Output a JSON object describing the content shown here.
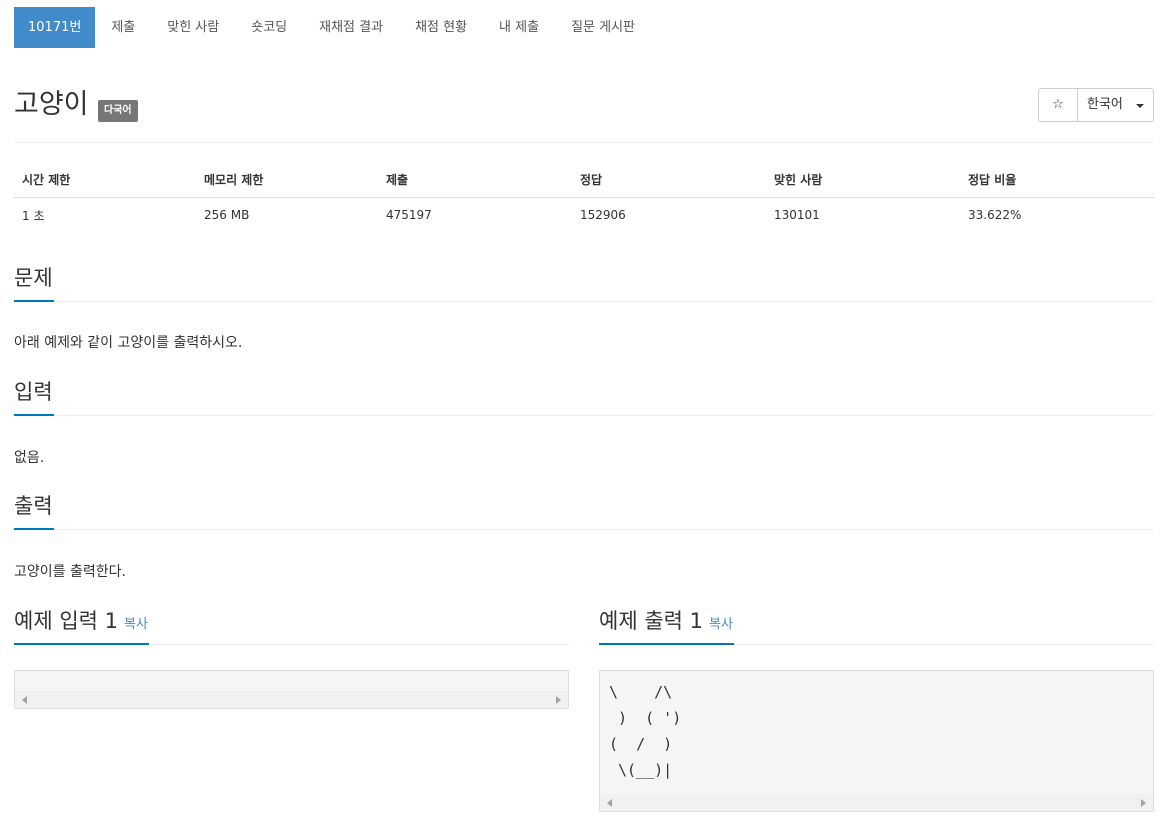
{
  "tabs": [
    {
      "label": "10171번",
      "active": true
    },
    {
      "label": "제출"
    },
    {
      "label": "맞힌 사람"
    },
    {
      "label": "숏코딩"
    },
    {
      "label": "재채점 결과"
    },
    {
      "label": "채점 현황"
    },
    {
      "label": "내 제출"
    },
    {
      "label": "질문 게시판"
    }
  ],
  "problem": {
    "title": "고양이",
    "badge": "다국어",
    "star_icon": "☆",
    "language": "한국어"
  },
  "info": {
    "headers": [
      "시간 제한",
      "메모리 제한",
      "제출",
      "정답",
      "맞힌 사람",
      "정답 비율"
    ],
    "values": [
      "1 초",
      "256 MB",
      "475197",
      "152906",
      "130101",
      "33.622%"
    ]
  },
  "sections": {
    "problem": {
      "heading": "문제",
      "text": "아래 예제와 같이 고양이를 출력하시오."
    },
    "input": {
      "heading": "입력",
      "text": "없음."
    },
    "output": {
      "heading": "출력",
      "text": "고양이를 출력한다."
    }
  },
  "samples": {
    "input_heading": "예제 입력 1",
    "output_heading": "예제 출력 1",
    "copy_label": "복사",
    "input_text": "",
    "output_text": "\\    /\\\n )  ( ')\n(  /  )\n \\(__)|"
  },
  "colors": {
    "accent": "#428bca",
    "heading_underline": "#0076c0",
    "badge": "#777777"
  }
}
